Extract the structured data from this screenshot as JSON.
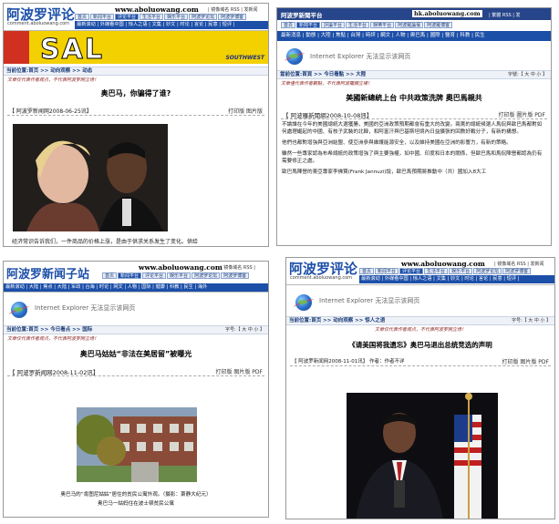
{
  "panel1": {
    "logo": "阿波罗评论",
    "logo_sub": "comment.aboluowang.com",
    "url": "www.aboluowang.com",
    "tools": "| 镜像域名 RSS | 发新闻",
    "tabs": [
      "首页",
      "新闻平台",
      "评论平台",
      "生活平台",
      "娱乐平台",
      "阿波罗论坛",
      "阿波罗博客"
    ],
    "subnav": "最新滚动 | 外媒看中国 | 惊人之语 | 文集 | 妙文 | 时论 | 言论 | 民意 | 短评 |",
    "ad_text": "SAL",
    "ad_brand": "SOUTHWEST",
    "breadcrumb": "当前位置:首页 >> 动向观察 >> 动态",
    "disclaimer": "文章仅代表作者观点，不代表阿波罗网立场！",
    "headline": "奥巴马，你骗得了谁?",
    "date": "【 阿波罗新闻网2008-06-25讯】",
    "tools_text": "打印版 图片版",
    "body": "经济常识告诉我们，一件商品的价格上涨，是由于供求关系发生了变化。供给"
  },
  "panel2": {
    "topbar": "阿波罗新聞平台",
    "url": "hk.aboluowang.com",
    "tools": "| 繁體 RSS | 发",
    "tabs": [
      "首頁",
      "新聞平台",
      "評論平台",
      "生活平台",
      "娛樂平台",
      "阿波羅論壇",
      "阿波羅博客"
    ],
    "navbar": "最新消息 | 動態 | 大陸 | 焦點 | 台灣 | 時評 | 網文 | 人物 | 奧巴馬 | 國際 | 醫育 | 科教 | 民生",
    "ie_text": "Internet Explorer 无法显示该网页",
    "breadcrumb": "當前位置:首頁 >> 今日看點 >> 大陸",
    "font": "字號:【 大 中 小 】",
    "disclaimer": "文章僅代表作者觀點，不代表阿波羅網立場！",
    "headline": "美國新總統上台 中共政策洗牌 奧巴馬親共",
    "date": "【 阿波羅新聞網2008-10-08訊】",
    "tools_text": "打印版 圖片版 PDF",
    "paragraphs": [
      "不論誰在今年的美國總統大選獲勝，美國的亞洲政策預期都會有重大的改變。兩黨的總統候選人馬侃與歐巴馬都對如何處理崛起的中國、有核子武裝的北韓，和阿富汗與巴基斯坦境內日益擴張的回教好戰分子，有新的構想。",
      "他們也都對增強與亞洲結盟、使亞洲參與維護能源安全，以及維持美國在亞洲的影響力，有新的策略。",
      "雖然一些專家認為布希總統的政策增強了與主要強權，如中國、印度和日本的關係，但歐巴馬和馬侃陣營都認為仍有需要修正之處。",
      "歐巴馬陣營的東亞專家李佛賢(Frank Jannuzi)說，歐巴馬預期將推動中（共）國加入8大工"
    ]
  },
  "panel3": {
    "logo": "阿波罗新闻子站",
    "url": "www.aboluowang.com",
    "tools": "| 镜像域名 RSS |",
    "tabs": [
      "首页",
      "新闻平台",
      "评论平台",
      "娱乐平台",
      "阿波罗论坛",
      "阿波罗博客"
    ],
    "subnav": "最新滚动 | 大陆 | 焦点 | 大陆 | 军政 | 台海 | 时论 | 网文 | 人物 | 国际 | 健康 | 科教 | 民生 | 海外",
    "ie_text": "Internet Explorer 无法显示该网页",
    "breadcrumb": "当前位置:首页 >> 今日看点 >> 国际",
    "font": "字号:【 大 中 小 】",
    "disclaimer": "文章仅代表作者观点，不代表阿波罗网立场！",
    "headline": "奥巴马姑姑“非法在美居留”被曝光",
    "date": "【 阿波罗新闻网2008-11-02讯】",
    "tools_text": "打印版 图片版 PDF",
    "caption1": "奥巴马的“肯图尼姑姑”居住的贫民公寓外观。（摄影：萧静大纪元）",
    "caption2": "奥巴马一姑妈住在波士顿贫民公寓"
  },
  "panel4": {
    "logo": "阿波罗评论",
    "logo_sub": "comment.aboluowang.com",
    "url": "www.aboluowang.com",
    "tools": "| 镜像域名 RSS | 发新闻",
    "tabs": [
      "首页",
      "新闻平台",
      "评论平台",
      "生活平台",
      "娱乐平台",
      "阿波罗论坛",
      "阿波罗博客"
    ],
    "subnav": "最新滚动 | 外媒看中国 | 惊人之语 | 文集 | 妙文 | 时论 | 言论 | 民意 | 短评 |",
    "ie_text": "Internet Explorer 无法显示该网页",
    "breadcrumb": "当前位置:首页 >> 动向观察 >> 惊人之语",
    "font": "字号:【 大 中 小 】",
    "disclaimer": "文章仅代表作者观点，不代表阿波罗网立场！",
    "headline": "《请美国将我遗忘》奥巴马退出总统竞选的声明",
    "date": "【 阿波罗新闻网2008-11-01讯】 作者：作者不详",
    "tools_text": "打印版 图片版 PDF"
  }
}
